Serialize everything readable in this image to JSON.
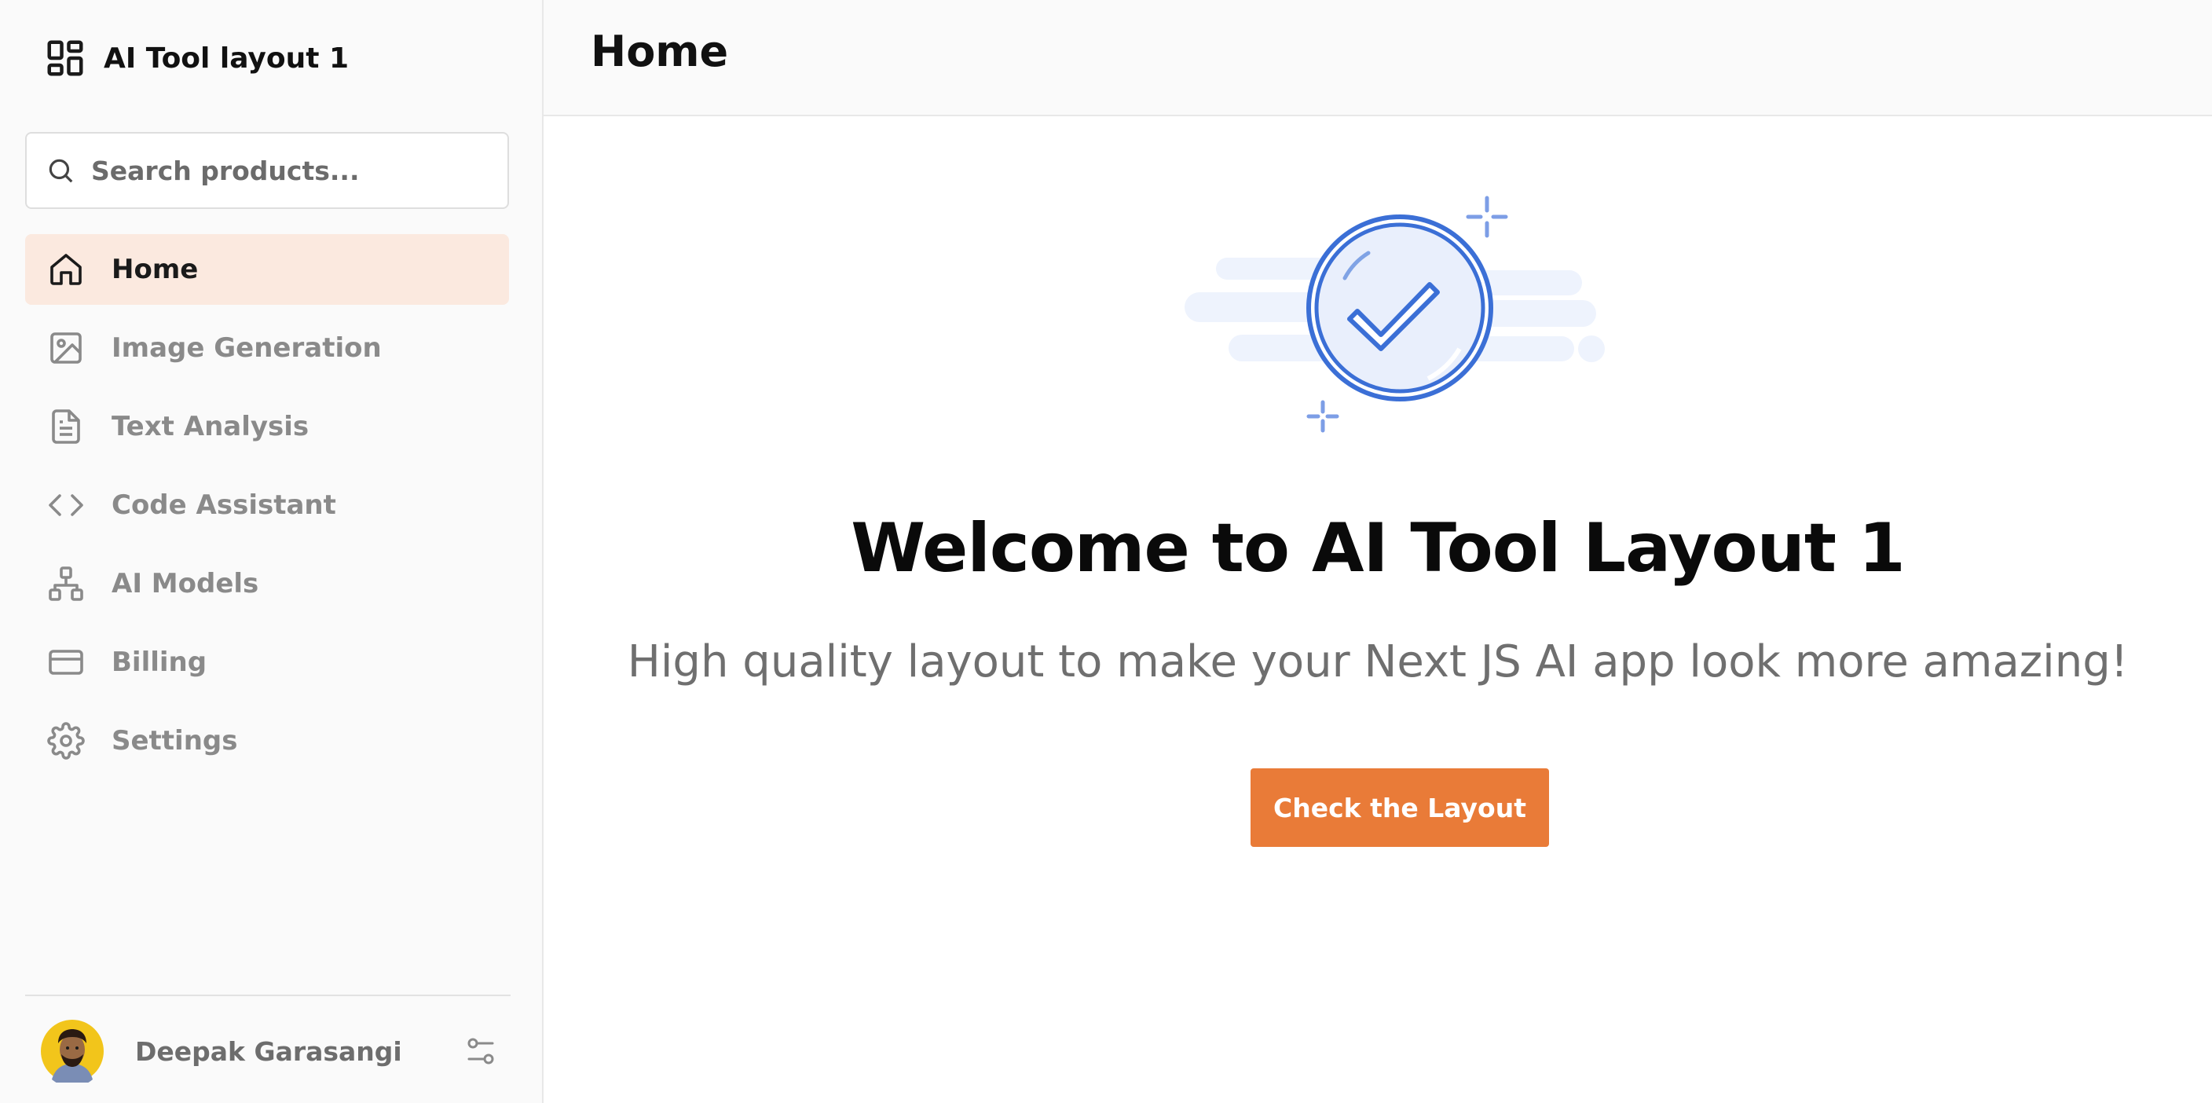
{
  "app": {
    "title": "AI Tool layout 1",
    "logo_icon": "layout-grid-icon"
  },
  "search": {
    "placeholder": "Search products...",
    "value": "",
    "icon": "search-icon"
  },
  "sidebar": {
    "items": [
      {
        "label": "Home",
        "icon": "home-icon",
        "active": true
      },
      {
        "label": "Image Generation",
        "icon": "image-icon",
        "active": false
      },
      {
        "label": "Text Analysis",
        "icon": "file-text-icon",
        "active": false
      },
      {
        "label": "Code Assistant",
        "icon": "code-icon",
        "active": false
      },
      {
        "label": "AI Models",
        "icon": "network-icon",
        "active": false
      },
      {
        "label": "Billing",
        "icon": "credit-card-icon",
        "active": false
      },
      {
        "label": "Settings",
        "icon": "gear-icon",
        "active": false
      }
    ]
  },
  "user": {
    "name": "Deepak Garasangi",
    "settings_icon": "sliders-icon"
  },
  "header": {
    "title": "Home"
  },
  "main": {
    "heading": "Welcome to AI Tool Layout 1",
    "subtitle": "High quality layout to make your Next JS AI app look more amazing!",
    "cta_label": "Check the Layout"
  },
  "colors": {
    "accent": "#e97b38",
    "active_nav_bg": "#fbe9df",
    "illustration_blue": "#3b6fd6",
    "illustration_bg": "#eef3fd"
  }
}
